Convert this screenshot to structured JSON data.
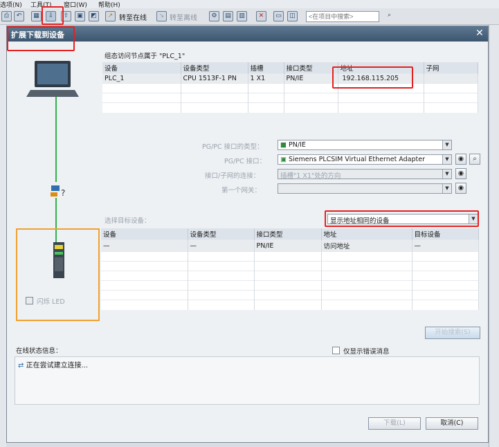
{
  "menu": {
    "items": [
      "选项(N)",
      "工具(T)",
      "窗口(W)",
      "帮助(H)"
    ]
  },
  "toolbar": {
    "go_online": "转至在线",
    "go_offline": "转至离线",
    "search_placeholder": "<在项目中搜索>"
  },
  "dialog": {
    "title": "扩展下载到设备",
    "config_caption": "组态访问节点属于 \"PLC_1\"",
    "config_table": {
      "headers": [
        "设备",
        "设备类型",
        "插槽",
        "接口类型",
        "地址",
        "子网"
      ],
      "rows": [
        [
          "PLC_1",
          "CPU 1513F-1 PN",
          "1 X1",
          "PN/IE",
          "192.168.115.205",
          ""
        ]
      ]
    },
    "pgpc_type_label": "PG/PC 接口的类型：",
    "pgpc_type_value": "PN/IE",
    "pgpc_iface_label": "PG/PC 接口：",
    "pgpc_iface_value": "Siemens PLCSIM Virtual Ethernet Adapter",
    "subnet_conn_label": "接口/子网的连接：",
    "subnet_conn_value": "插槽\"1 X1\"处的方向",
    "gateway_label": "第一个网关：",
    "gateway_value": "",
    "target_label": "选择目标设备：",
    "target_filter": "显示地址相同的设备",
    "target_table": {
      "headers": [
        "设备",
        "设备类型",
        "接口类型",
        "地址",
        "目标设备"
      ],
      "rows": [
        [
          "—",
          "—",
          "PN/IE",
          "访问地址",
          "—"
        ]
      ]
    },
    "flash_led": "闪烁 LED",
    "start_search": "开始搜索(S)",
    "status_caption": "在线状态信息：",
    "only_errors": "仅显示错误消息",
    "status_messages": [
      "正在尝试建立连接..."
    ],
    "download_button": "下载(L)",
    "cancel_button": "取消(C)"
  },
  "colors": {
    "highlight_red": "#e52020",
    "network_green": "#2fb34a",
    "device_box_orange": "#f0a030"
  }
}
